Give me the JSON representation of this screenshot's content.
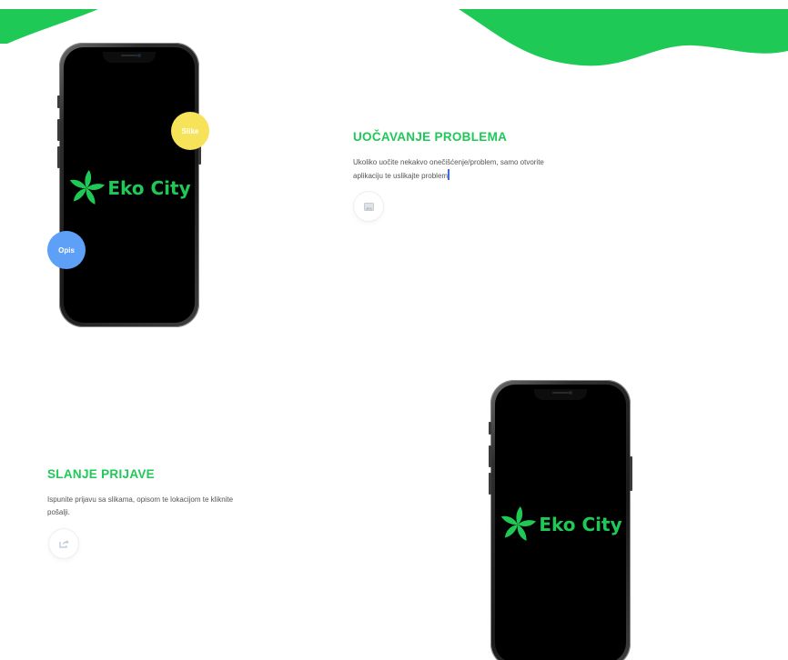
{
  "colors": {
    "accent_green": "#1ec956",
    "badge_yellow": "#f7e35a",
    "badge_blue": "#5e9ff8",
    "phone_screen": "#000000"
  },
  "phones": [
    {
      "logo_text": "Eko City",
      "logo_icon": "pinwheel-leaf-icon"
    },
    {
      "logo_text": "Eko City",
      "logo_icon": "pinwheel-leaf-icon"
    }
  ],
  "badges": {
    "yellow_label": "Slike",
    "blue_label": "Opis"
  },
  "features": [
    {
      "title": "UOČAVANJE PROBLEMA",
      "description_line1": "Ukoliko uočite nekakvo onečišćenje/problem, samo otvorite",
      "description_line2": "aplikaciju te uslikajte problem",
      "icon": "image-icon"
    },
    {
      "title": "SLANJE PRIJAVE",
      "description_line1": "Ispunite prijavu sa slikama, opisom te lokacijom te kliknite",
      "description_line2": "pošalji.",
      "icon": "share-icon"
    }
  ]
}
